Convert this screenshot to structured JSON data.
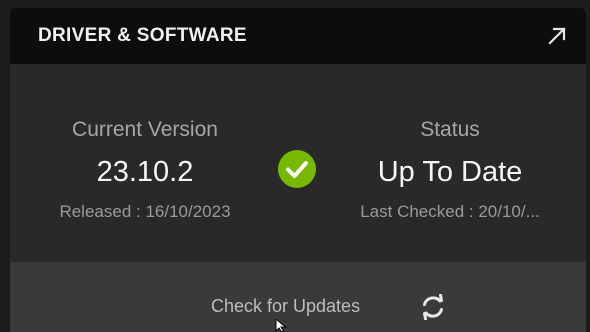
{
  "header": {
    "title": "DRIVER & SOFTWARE",
    "expand_icon": "expand-arrow-icon"
  },
  "current_version": {
    "label": "Current Version",
    "value": "23.10.2",
    "released": "Released : 16/10/2023"
  },
  "status": {
    "label": "Status",
    "value": "Up To Date",
    "last_checked": "Last Checked : 20/10/...",
    "icon": "check-circle-icon",
    "icon_color": "#76b900"
  },
  "footer": {
    "button_label": "Check for Updates",
    "icon": "refresh-icon"
  }
}
